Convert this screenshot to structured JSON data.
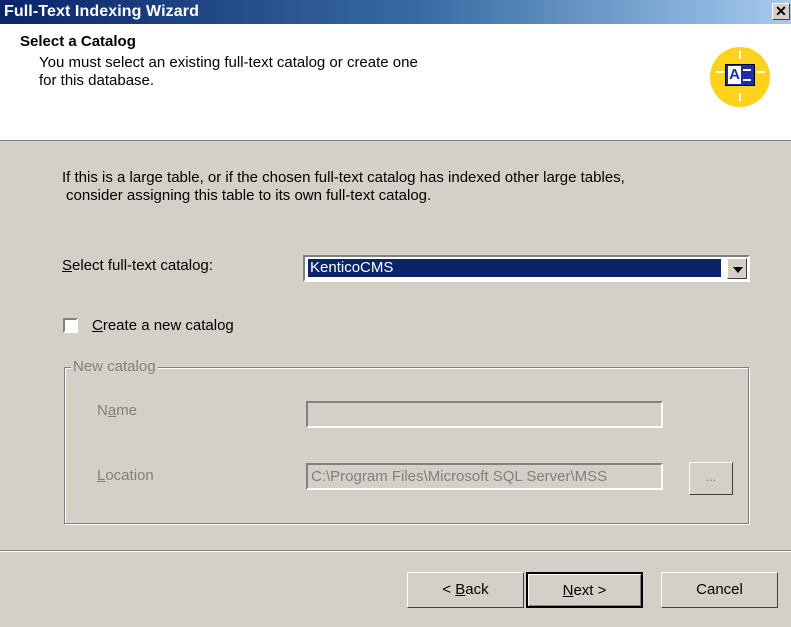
{
  "window": {
    "title": "Full-Text Indexing Wizard",
    "close_glyph": "✕"
  },
  "header": {
    "title": "Select a Catalog",
    "subtitle_line1": "You must select an existing full-text catalog or create one",
    "subtitle_line2": "for this database.",
    "icon": "fulltext-index-icon"
  },
  "body": {
    "info_line1": "If this is a large table, or if the chosen full-text catalog has indexed other large tables,",
    "info_line2": "consider assigning this table to its own full-text catalog.",
    "select_label_accel": "S",
    "select_label_rest": "elect full-text catalog:",
    "select_value": "KenticoCMS",
    "create_checkbox_accel": "C",
    "create_checkbox_rest": "reate a new catalog",
    "create_checked": false
  },
  "new_catalog": {
    "group_label": "New catalog",
    "name_label_pre": "N",
    "name_label_accel": "a",
    "name_label_post": "me",
    "name_value": "",
    "location_label_accel": "L",
    "location_label_rest": "ocation",
    "location_value": "C:\\Program Files\\Microsoft SQL Server\\MSS",
    "browse_label": "..."
  },
  "footer": {
    "back_pre": "< ",
    "back_accel": "B",
    "back_rest": "ack",
    "next_accel": "N",
    "next_rest": "ext >",
    "cancel_label": "Cancel"
  }
}
